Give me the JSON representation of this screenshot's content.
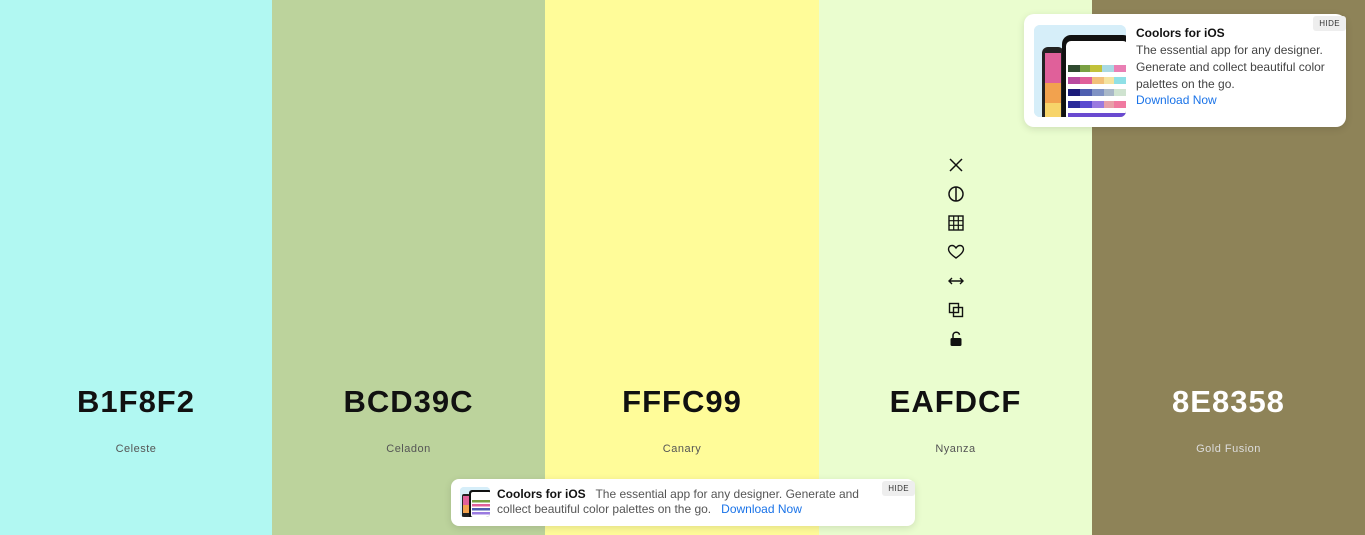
{
  "palette": [
    {
      "hex": "B1F8F2",
      "name": "Celeste",
      "bg": "#B1F8F2",
      "text_color": "#111111",
      "name_color": "#555555"
    },
    {
      "hex": "BCD39C",
      "name": "Celadon",
      "bg": "#BCD39C",
      "text_color": "#111111",
      "name_color": "#555555"
    },
    {
      "hex": "FFFC99",
      "name": "Canary",
      "bg": "#FFFC99",
      "text_color": "#111111",
      "name_color": "#555555"
    },
    {
      "hex": "EAFDCF",
      "name": "Nyanza",
      "bg": "#EAFDCF",
      "text_color": "#111111",
      "name_color": "#555555"
    },
    {
      "hex": "8E8358",
      "name": "Gold Fusion",
      "bg": "#8E8358",
      "text_color": "#ffffff",
      "name_color": "#dddddd"
    }
  ],
  "tools": [
    "close-icon",
    "contrast-icon",
    "shades-grid-icon",
    "heart-icon",
    "drag-arrows-icon",
    "copy-icon",
    "unlock-icon"
  ],
  "ad_card": {
    "title": "Coolors for iOS",
    "description": "The essential app for any designer. Generate and collect beautiful color palettes on the go.",
    "link": "Download Now",
    "hide": "HIDE"
  },
  "ad_bar": {
    "title": "Coolors for iOS",
    "description": "The essential app for any designer. Generate and collect beautiful color palettes on the go.",
    "link": "Download Now",
    "hide": "HIDE"
  }
}
